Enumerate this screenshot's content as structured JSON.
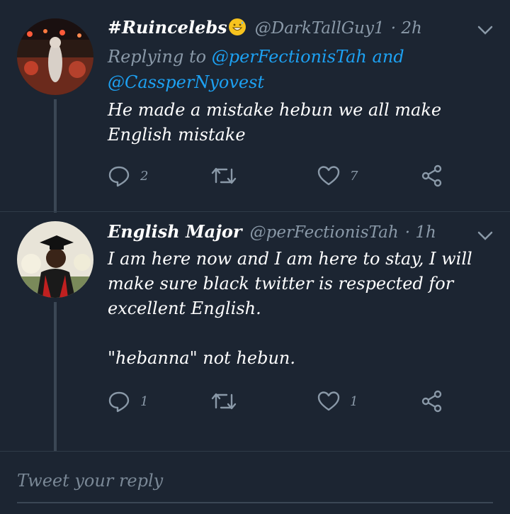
{
  "tweets": [
    {
      "name": "#Ruincelebs",
      "handle": "@DarkTallGuy1",
      "time": "· 2h",
      "replying_prefix": "Replying to ",
      "replying_user1": "@perFectionisTah",
      "replying_and": " and",
      "replying_user2": "@CassperNyovest",
      "text": "He made a mistake hebun we all make\nEnglish mistake",
      "replies": "2",
      "retweets": "",
      "likes": "7"
    },
    {
      "name": "English Major",
      "handle": "@perFectionisTah",
      "time": "· 1h",
      "text": "I am here now and I am here to stay, I will\nmake sure black twitter is respected for\nexcellent English.\n\n\"hebanna\" not hebun.",
      "replies": "1",
      "retweets": "",
      "likes": "1"
    }
  ],
  "reply_placeholder": "Tweet your reply",
  "icons": {
    "reply": "reply-icon",
    "retweet": "retweet-icon",
    "like": "heart-icon",
    "share": "share-icon",
    "chevron": "chevron-down-icon",
    "emoji": "grinning-sweat-emoji"
  },
  "colors": {
    "background": "#1c2532",
    "mention": "#1da1f2",
    "muted": "#8a99a8"
  }
}
